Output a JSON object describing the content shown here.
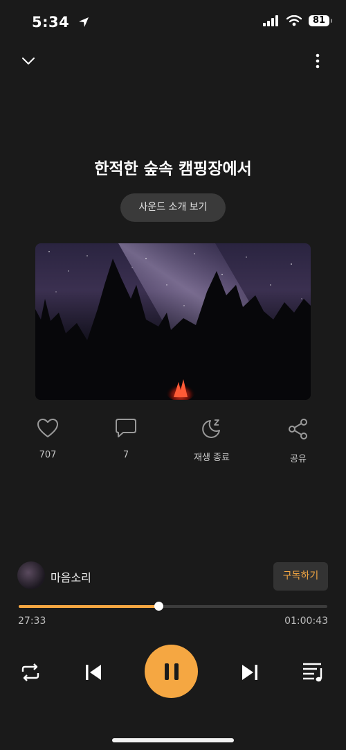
{
  "status_bar": {
    "time": "5:34",
    "battery": "81"
  },
  "header": {
    "collapse_icon": "chevron-down-icon",
    "menu_icon": "more-vertical-icon"
  },
  "title": "한적한 숲속 캠핑장에서",
  "intro_button": "사운드 소개 보기",
  "actions": [
    {
      "icon": "heart-icon",
      "label": "707"
    },
    {
      "icon": "comment-icon",
      "label": "7"
    },
    {
      "icon": "sleep-timer-icon",
      "label": "재생 종료"
    },
    {
      "icon": "share-icon",
      "label": "공유"
    }
  ],
  "channel": {
    "name": "마음소리",
    "subscribe_label": "구독하기"
  },
  "progress": {
    "elapsed": "27:33",
    "total": "01:00:43",
    "fraction": 0.454
  },
  "colors": {
    "accent": "#f5a742",
    "background": "#1a1a1a"
  }
}
